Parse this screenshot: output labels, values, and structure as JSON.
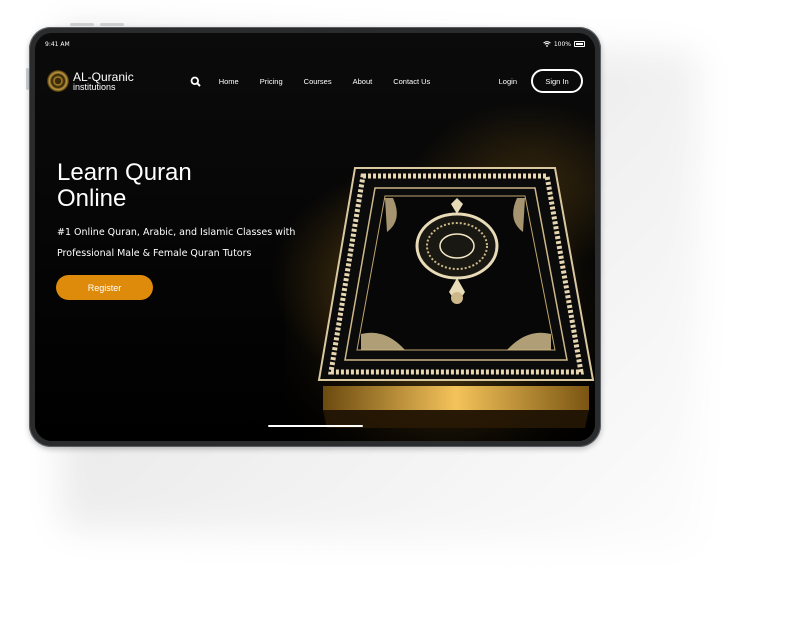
{
  "status_bar": {
    "time": "9:41 AM",
    "battery": "100%"
  },
  "brand": {
    "title": "AL-Quranic",
    "subtitle": "institutions"
  },
  "nav": {
    "links": [
      {
        "label": "Home"
      },
      {
        "label": "Pricing"
      },
      {
        "label": "Courses"
      },
      {
        "label": "About"
      },
      {
        "label": "Contact Us"
      }
    ],
    "login_label": "Login",
    "signin_label": "Sign In"
  },
  "hero": {
    "title_line1": "Learn Quran",
    "title_line2": "Online",
    "subtitle_line1": "#1 Online Quran, Arabic, and Islamic Classes with",
    "subtitle_line2": "Professional Male & Female Quran Tutors",
    "register_label": "Register"
  },
  "colors": {
    "accent": "#de8a0a",
    "background": "#050505",
    "text": "#ffffff"
  },
  "icons": [
    "search-icon",
    "wifi-icon",
    "battery-icon",
    "logo-emblem-icon"
  ]
}
